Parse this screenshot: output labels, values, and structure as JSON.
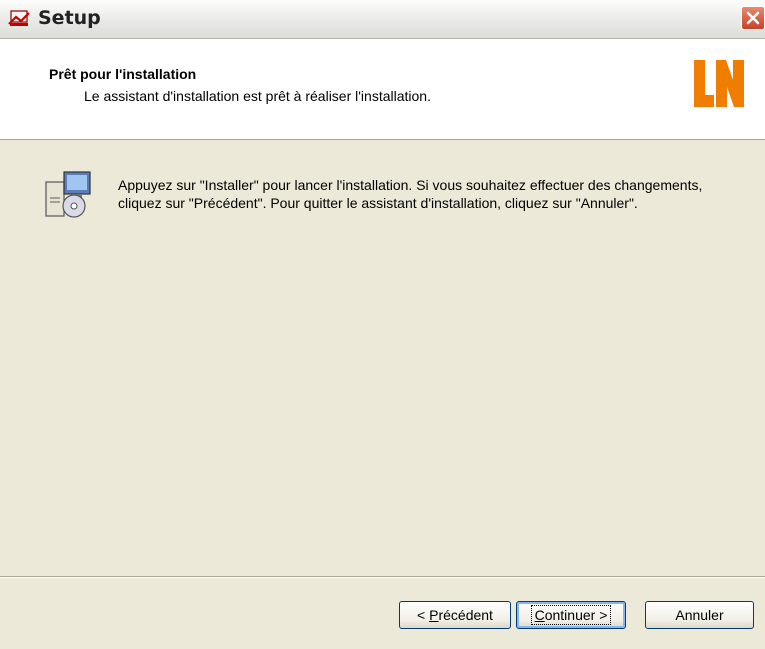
{
  "window": {
    "title": "Setup",
    "icon": "setup-app-icon",
    "close_icon": "close-icon"
  },
  "header": {
    "title": "Prêt pour l'installation",
    "subtitle": "Le assistant d'installation est prêt à réaliser l'installation.",
    "logo_text": "LN",
    "logo_color": "#ee7d00"
  },
  "main": {
    "icon": "install-package-icon",
    "message": "Appuyez sur \"Installer\" pour lancer l'installation. Si vous souhaitez effectuer des changements, cliquez sur \"Précédent\". Pour quitter le assistant d'installation, cliquez sur \"Annuler\"."
  },
  "buttons": {
    "back_prefix": "< ",
    "back_accel": "P",
    "back_rest": "récédent",
    "next_accel": "C",
    "next_rest": "ontinuer >",
    "cancel_label": "Annuler"
  },
  "colors": {
    "dialog_bg": "#ece9d8",
    "close_button": "#c8412a",
    "button_border": "#003c74"
  }
}
